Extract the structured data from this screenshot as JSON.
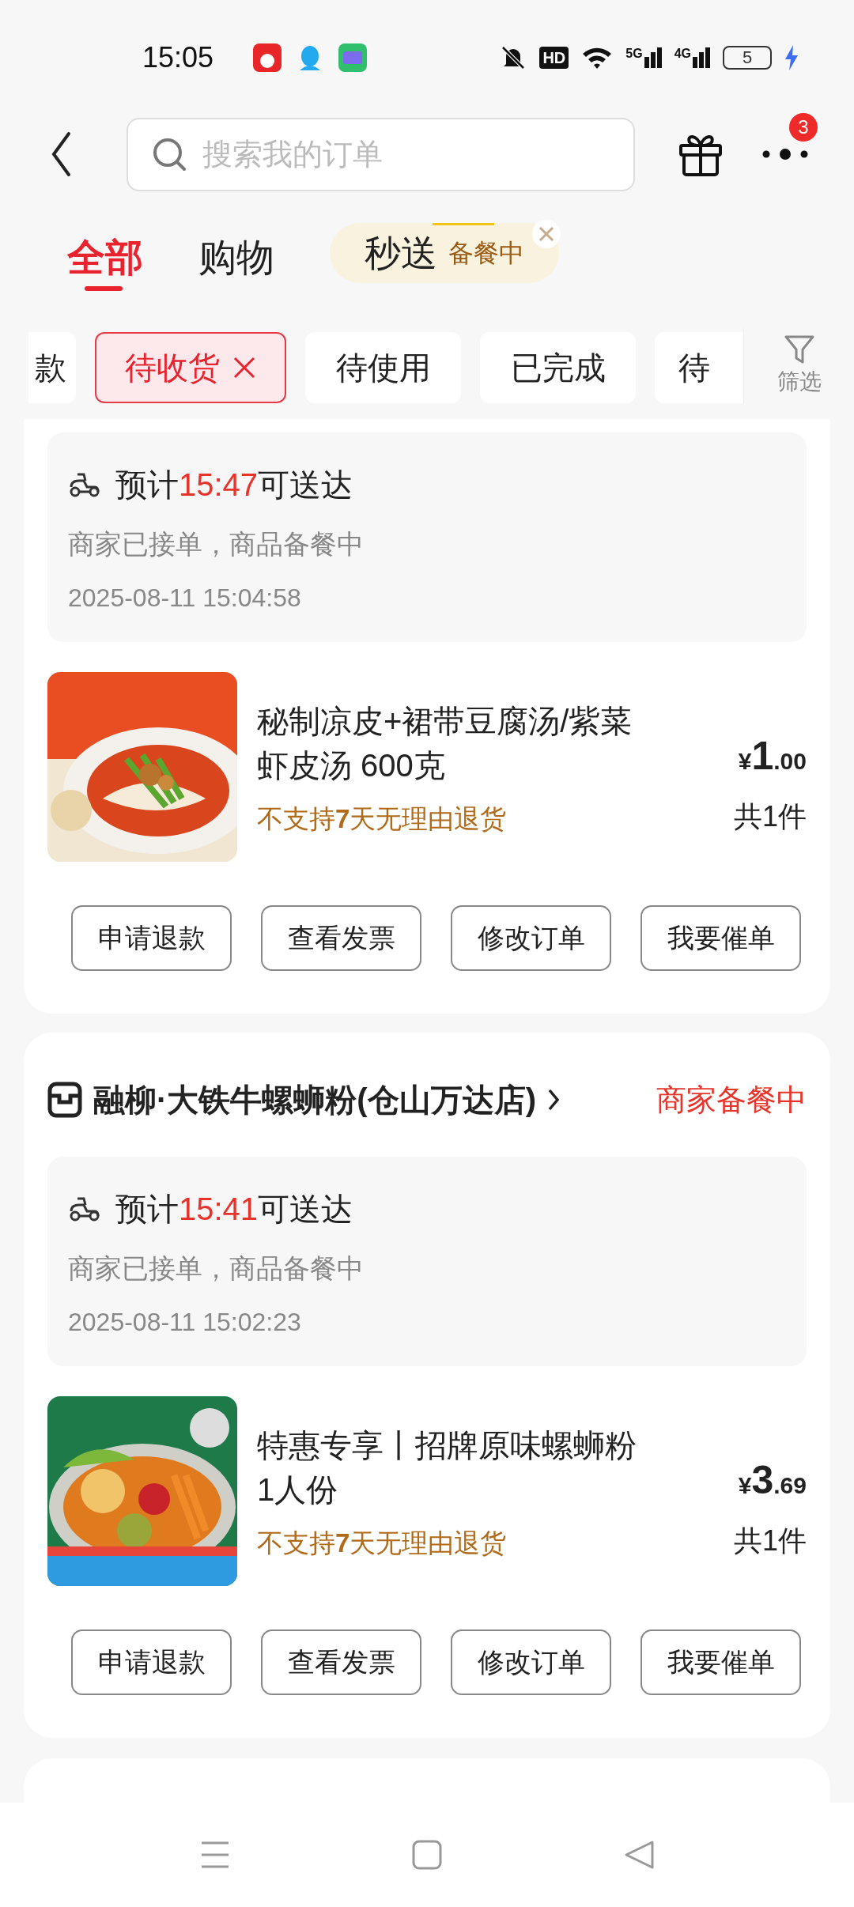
{
  "status_bar": {
    "time": "15:05",
    "hd": "HD",
    "networks": [
      "5G",
      "4G"
    ],
    "battery": "5",
    "charging": true
  },
  "header": {
    "search": {
      "placeholder": "搜索我的订单"
    },
    "more_badge": "3"
  },
  "tabs": [
    {
      "label": "全部",
      "selected": true,
      "kind": "text"
    },
    {
      "label": "购物",
      "selected": false,
      "kind": "text"
    },
    {
      "label": "秒送",
      "status": "备餐中",
      "selected": false,
      "kind": "pill"
    }
  ],
  "filters": {
    "chips": [
      {
        "label": "款",
        "selected": false
      },
      {
        "label": "待收货",
        "selected": true
      },
      {
        "label": "待使用",
        "selected": false
      },
      {
        "label": "已完成",
        "selected": false
      },
      {
        "label": "待",
        "selected": false
      }
    ],
    "filter_button": "筛选"
  },
  "orders": [
    {
      "delivery": {
        "prefix": "预计",
        "time": "15:47",
        "suffix": "可送达",
        "status": "商家已接单，商品备餐中",
        "timestamp": "2025-08-11 15:04:58"
      },
      "product": {
        "title": "秘制凉皮+裙带豆腐汤/紫菜虾皮汤 600克",
        "note": "不支持**7**天无理由退货",
        "currency": "¥",
        "price_int": "1",
        "price_dec": ".00",
        "quantity": "共1件"
      },
      "actions": [
        "申请退款",
        "查看发票",
        "修改订单",
        "我要催单"
      ]
    },
    {
      "store": {
        "name": "融柳·大铁牛螺蛳粉(仓山万达店)",
        "status": "商家备餐中"
      },
      "delivery": {
        "prefix": "预计",
        "time": "15:41",
        "suffix": "可送达",
        "status": "商家已接单，商品备餐中",
        "timestamp": "2025-08-11 15:02:23"
      },
      "product": {
        "title": "特惠专享丨招牌原味螺蛳粉1人份",
        "note": "不支持**7**天无理由退货",
        "currency": "¥",
        "price_int": "3",
        "price_dec": ".69",
        "quantity": "共1件"
      },
      "actions": [
        "申请退款",
        "查看发票",
        "修改订单",
        "我要催单"
      ]
    }
  ]
}
